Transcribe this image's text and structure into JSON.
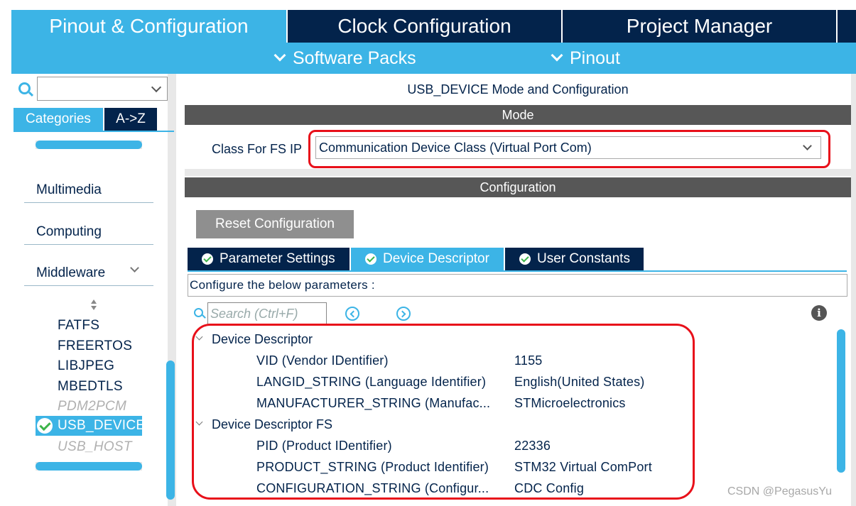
{
  "top_tabs": {
    "pinout": "Pinout & Configuration",
    "clock": "Clock Configuration",
    "project": "Project Manager"
  },
  "subbar": {
    "software_packs": "Software Packs",
    "pinout": "Pinout"
  },
  "sidebar": {
    "search_value": "",
    "tabs": {
      "categories": "Categories",
      "az": "A->Z"
    },
    "sections": {
      "multimedia": "Multimedia",
      "computing": "Computing",
      "middleware": "Middleware"
    },
    "middleware_items": [
      "FATFS",
      "FREERTOS",
      "LIBJPEG",
      "MBEDTLS",
      "PDM2PCM",
      "USB_DEVICE",
      "USB_HOST"
    ],
    "selected": "USB_DEVICE"
  },
  "main": {
    "title": "USB_DEVICE Mode and Configuration",
    "mode_header": "Mode",
    "class_label": "Class For FS IP",
    "class_value": "Communication Device Class (Virtual Port Com)",
    "config_header": "Configuration",
    "reset_button": "Reset Configuration",
    "param_tabs": [
      "Parameter Settings",
      "Device Descriptor",
      "User Constants"
    ],
    "active_tab": "Device Descriptor",
    "hint": "Configure the below parameters :",
    "search_placeholder": "Search (Ctrl+F)",
    "info_glyph": "i",
    "groups": [
      {
        "name": "Device Descriptor",
        "params": [
          {
            "name": "VID (Vendor IDentifier)",
            "value": "1155"
          },
          {
            "name": "LANGID_STRING (Language Identifier)",
            "value": "English(United States)"
          },
          {
            "name": "MANUFACTURER_STRING (Manufac...",
            "value": "STMicroelectronics"
          }
        ]
      },
      {
        "name": "Device Descriptor FS",
        "params": [
          {
            "name": "PID (Product IDentifier)",
            "value": "22336"
          },
          {
            "name": "PRODUCT_STRING (Product Identifier)",
            "value": "STM32 Virtual ComPort"
          },
          {
            "name": "CONFIGURATION_STRING (Configur...",
            "value": "CDC Config"
          }
        ]
      }
    ]
  },
  "watermark": "CSDN @PegasusYu",
  "colors": {
    "accent": "#3cb4e6",
    "navy": "#03234b",
    "highlight_red": "#e8101a",
    "band_gray": "#575757"
  }
}
